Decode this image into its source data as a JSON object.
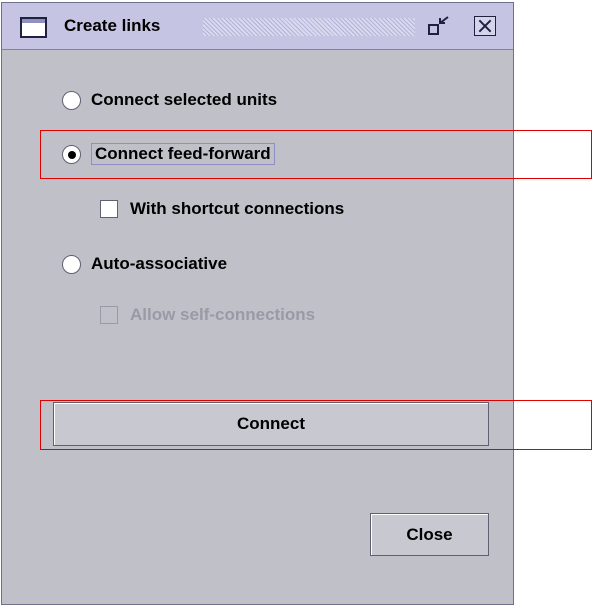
{
  "window": {
    "title": "Create links"
  },
  "options": {
    "connect_selected": "Connect selected units",
    "connect_feed_forward": "Connect feed-forward",
    "with_shortcut": "With shortcut connections",
    "auto_associative": "Auto-associative",
    "allow_self": "Allow self-connections"
  },
  "state": {
    "selected_option": "Connect feed-forward",
    "with_shortcut_checked": false,
    "allow_self_checked": false,
    "allow_self_enabled": false
  },
  "buttons": {
    "connect": "Connect",
    "close": "Close"
  },
  "colors": {
    "highlight": "#e00000",
    "window_bg": "#c0c0c8",
    "titlebar_bg": "#c5c5e3"
  },
  "icons": {
    "window": "window-icon",
    "minimize": "minimize-icon",
    "close": "close-icon"
  }
}
